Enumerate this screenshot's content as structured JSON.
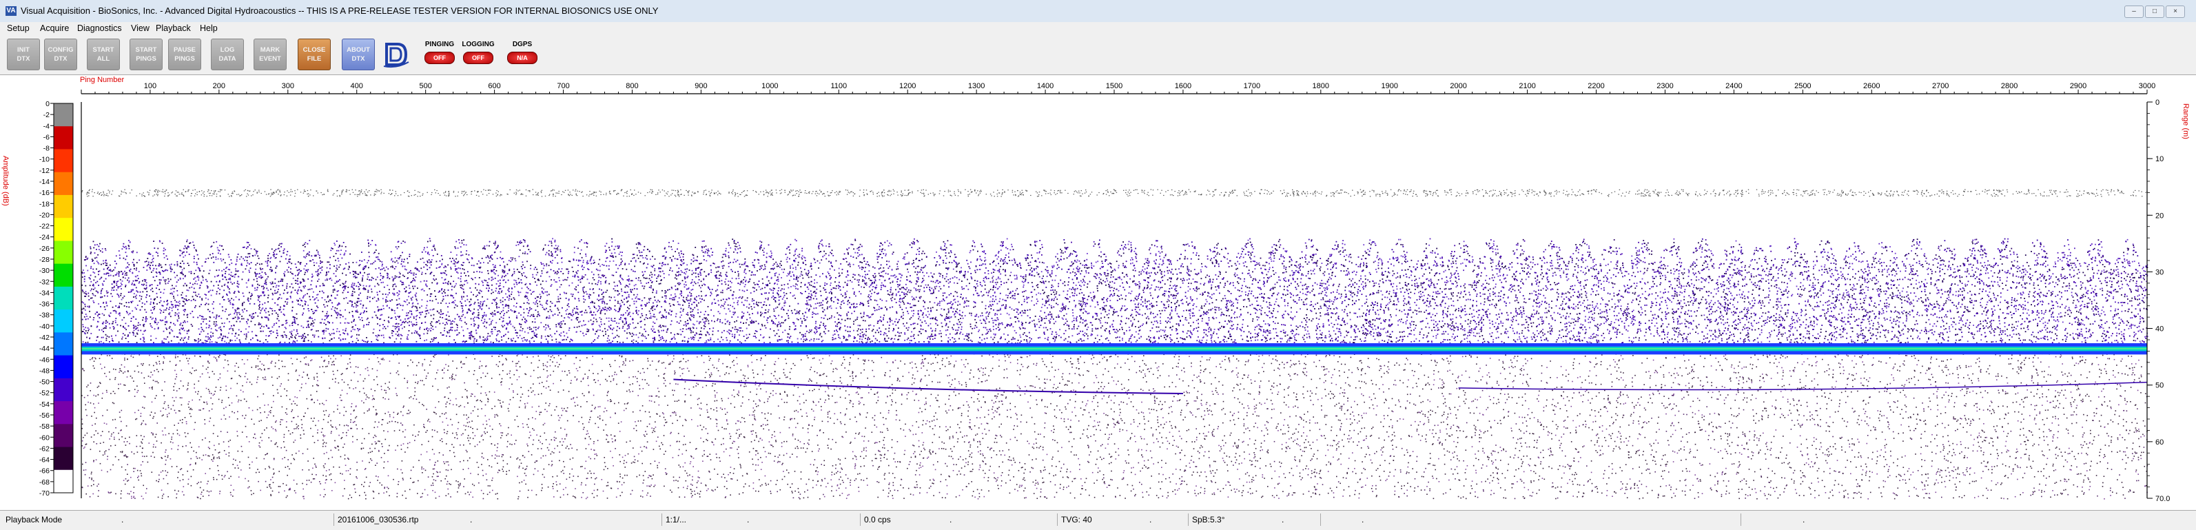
{
  "window": {
    "icon_text": "VA",
    "title": "Visual Acquisition  -  BioSonics, Inc.  -  Advanced Digital Hydroacoustics  -- THIS IS A PRE-RELEASE TESTER VERSION FOR INTERNAL BIOSONICS USE ONLY",
    "controls": [
      "–",
      "□",
      "×"
    ]
  },
  "menu": [
    "Setup",
    "Acquire",
    "Diagnostics",
    "View",
    "Playback",
    "Help"
  ],
  "toolbar": {
    "buttons": [
      {
        "line1": "INIT",
        "line2": "DTX",
        "style": "gray"
      },
      {
        "line1": "CONFIG",
        "line2": "DTX",
        "style": "gray"
      },
      {
        "line1": "START",
        "line2": "ALL",
        "style": "gray"
      },
      {
        "line1": "START",
        "line2": "PINGS",
        "style": "gray"
      },
      {
        "line1": "PAUSE",
        "line2": "PINGS",
        "style": "gray"
      },
      {
        "line1": "LOG",
        "line2": "DATA",
        "style": "gray"
      },
      {
        "line1": "MARK",
        "line2": "EVENT",
        "style": "gray"
      },
      {
        "line1": "CLOSE",
        "line2": "FILE",
        "style": "orange"
      },
      {
        "line1": "ABOUT",
        "line2": "DTX",
        "style": "blue"
      }
    ],
    "status": [
      {
        "label": "PINGING",
        "value": "OFF"
      },
      {
        "label": "LOGGING",
        "value": "OFF"
      },
      {
        "label": "DGPS",
        "value": "N/A"
      }
    ]
  },
  "plot": {
    "x_axis_label": "Ping Number",
    "left_axis_label": "Amplitude (dB)",
    "right_axis_label": "Range (m)",
    "x_ticks": [
      "100",
      "200",
      "300",
      "400",
      "500",
      "600",
      "700",
      "800",
      "900",
      "1000",
      "1100",
      "1200",
      "1300",
      "1400",
      "1500",
      "1600",
      "1700",
      "1800",
      "1900",
      "2000",
      "2100",
      "2200",
      "2300",
      "2400",
      "2500",
      "2600",
      "2700",
      "2800",
      "2900",
      "3000"
    ],
    "x_range": [
      0,
      3000
    ],
    "amp_ticks": [
      "0",
      "-2",
      "-4",
      "-6",
      "-8",
      "-10",
      "-12",
      "-14",
      "-16",
      "-18",
      "-20",
      "-22",
      "-24",
      "-26",
      "-28",
      "-30",
      "-32",
      "-34",
      "-36",
      "-38",
      "-40",
      "-42",
      "-44",
      "-46",
      "-48",
      "-50",
      "-52",
      "-54",
      "-56",
      "-58",
      "-60",
      "-62",
      "-64",
      "-66",
      "-68",
      "-70"
    ],
    "amp_range": [
      0,
      -70
    ],
    "range_ticks": [
      "0",
      "10",
      "20",
      "30",
      "40",
      "50",
      "60",
      "70.0"
    ],
    "range_max_m": 70,
    "colormap": [
      "#8c8c8c",
      "#cc0000",
      "#ff3300",
      "#ff7700",
      "#ffcc00",
      "#ffff00",
      "#88ff00",
      "#00dd00",
      "#00ddbb",
      "#00ccff",
      "#0077ff",
      "#0000ff",
      "#4400cc",
      "#7700aa",
      "#550066",
      "#2a0033",
      "#ffffff"
    ]
  },
  "statusbar": {
    "mode": "Playback Mode",
    "file": "20161006_030536.rtp",
    "ratio": "1:1/...",
    "cps": "0.0 cps",
    "tvg": "TVG: 40",
    "spb": "SpB:5.3°",
    "dots": [
      ".",
      ".",
      ".",
      ".",
      ".",
      ".",
      ".",
      "."
    ]
  }
}
